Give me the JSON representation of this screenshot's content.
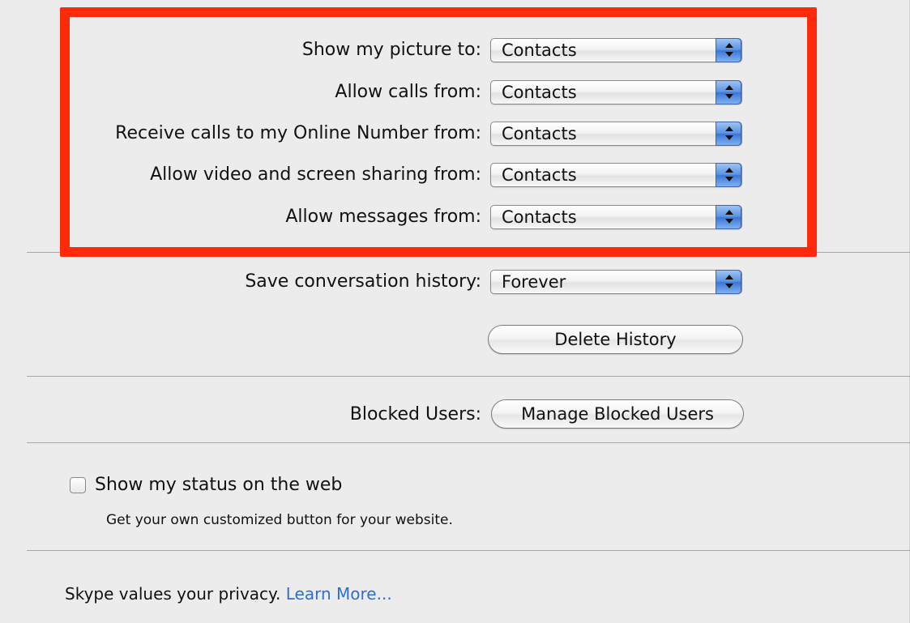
{
  "privacy": {
    "rows": [
      {
        "label": "Show my picture to:",
        "value": "Contacts"
      },
      {
        "label": "Allow calls from:",
        "value": "Contacts"
      },
      {
        "label": "Receive calls to my Online Number from:",
        "value": "Contacts"
      },
      {
        "label": "Allow video and screen sharing from:",
        "value": "Contacts"
      },
      {
        "label": "Allow messages from:",
        "value": "Contacts"
      }
    ],
    "history": {
      "label": "Save conversation history:",
      "value": "Forever",
      "delete_button": "Delete History"
    },
    "blocked": {
      "label": "Blocked Users:",
      "button": "Manage Blocked Users"
    },
    "web_status": {
      "checkbox_label": "Show my status on the web",
      "checked": false,
      "description": "Get your own customized button for your website."
    },
    "footer": {
      "text": "Skype values your privacy.",
      "link": "Learn More..."
    }
  },
  "colors": {
    "panel_background": "#ececec",
    "highlight": "#ff2a0a",
    "link": "#2f6ed2",
    "popup_arrow_blue": "#3a76d6"
  },
  "icons": [
    "popup-arrows-icon",
    "checkbox-icon"
  ]
}
